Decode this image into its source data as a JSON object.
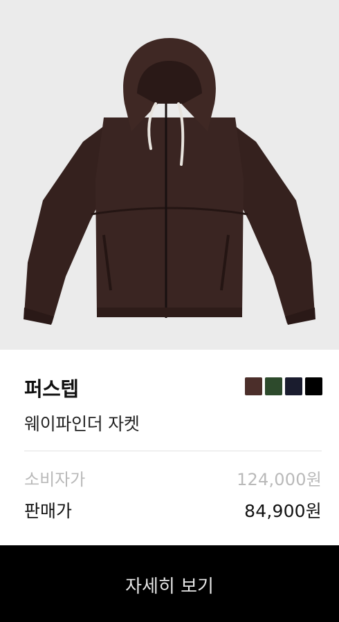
{
  "product": {
    "image_alt": "브라운 후드 자켓",
    "brand": "퍼스텝",
    "name": "웨이파인더 자켓",
    "color_swatches": [
      {
        "name": "brown",
        "hex": "#4b2e2a"
      },
      {
        "name": "green",
        "hex": "#2d4a2c"
      },
      {
        "name": "navy",
        "hex": "#1a1c2e"
      },
      {
        "name": "black",
        "hex": "#000000"
      }
    ]
  },
  "pricing": {
    "msrp_label": "소비자가",
    "msrp_value": "124,000원",
    "sale_label": "판매가",
    "sale_value": "84,900원"
  },
  "cta": {
    "label": "자세히 보기"
  },
  "colors": {
    "image_background": "#ebebeb",
    "jacket": "#3a2522",
    "cta_background": "#000000",
    "muted_text": "#b9b9b9"
  }
}
